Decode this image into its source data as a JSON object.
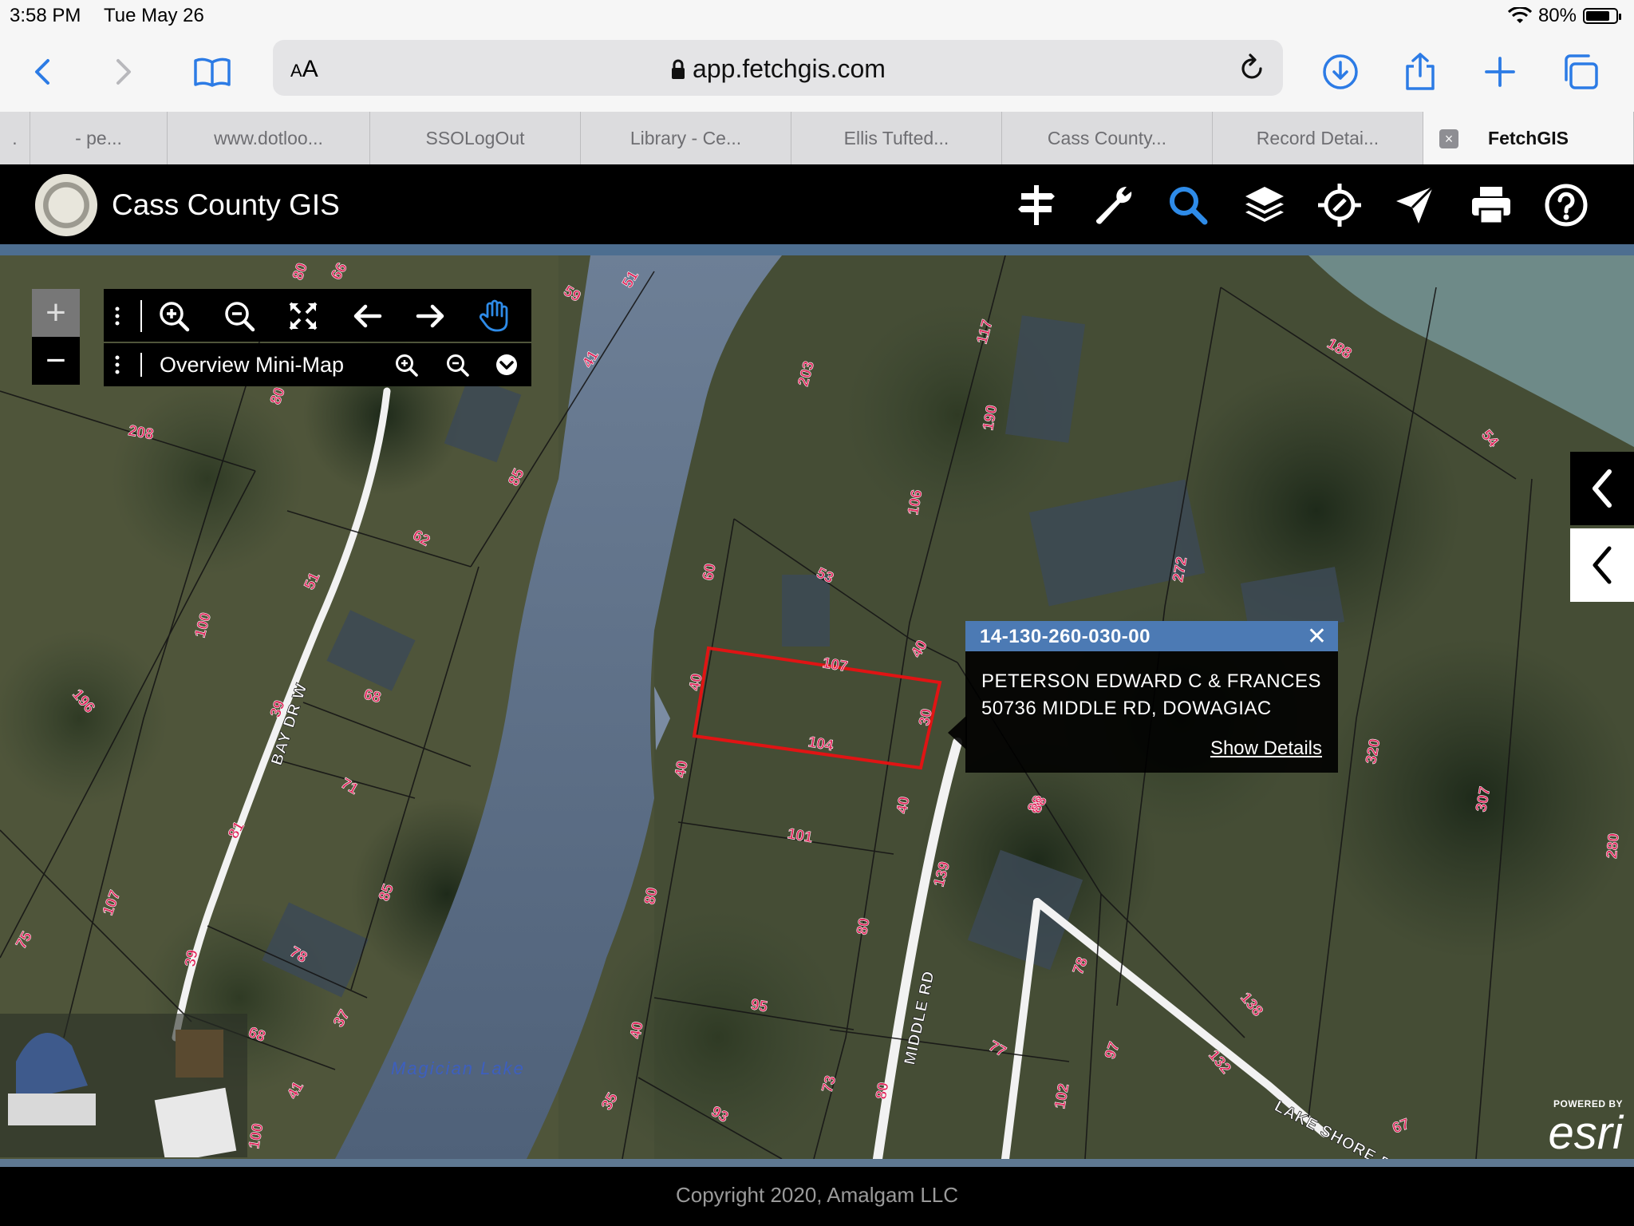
{
  "status_bar": {
    "time": "3:58 PM",
    "date": "Tue May 26",
    "battery_text": "80%",
    "battery_level": 0.8
  },
  "browser": {
    "text_size_label_small": "A",
    "text_size_label_big": "A",
    "url": "app.fetchgis.com",
    "icons": [
      "back-icon",
      "forward-icon",
      "bookmarks-icon",
      "lock-icon",
      "reload-icon",
      "download-icon",
      "share-icon",
      "new-tab-icon",
      "tabs-icon"
    ],
    "tabs": [
      {
        "label": "."
      },
      {
        "label": "- pe..."
      },
      {
        "label": "www.dotloo..."
      },
      {
        "label": "SSOLogOut"
      },
      {
        "label": "Library - Ce..."
      },
      {
        "label": "Ellis Tufted..."
      },
      {
        "label": "Cass County..."
      },
      {
        "label": "Record Detai..."
      },
      {
        "label": "FetchGIS",
        "active": true,
        "close_glyph": "×"
      }
    ]
  },
  "app": {
    "title": "Cass County GIS",
    "header_icons": [
      "directions-icon",
      "wrench-icon",
      "search-icon",
      "layers-icon",
      "locate-icon",
      "navigate-icon",
      "print-icon",
      "help-icon"
    ],
    "active_header_icon": "search-icon",
    "accent_color": "#4c7ab4"
  },
  "map_controls": {
    "zoom_in": "+",
    "zoom_out": "−",
    "tool_icons": [
      "zoom-in-icon",
      "zoom-out-icon",
      "full-extent-icon",
      "previous-extent-icon",
      "next-extent-icon",
      "pan-hand-icon"
    ],
    "active_tool": "pan-hand-icon",
    "minimap_label": "Overview Mini-Map",
    "minimap_icons": [
      "minimap-zoom-in-icon",
      "minimap-zoom-out-icon",
      "minimap-toggle-icon"
    ]
  },
  "popup": {
    "parcel_id": "14-130-260-030-00",
    "close_glyph": "✕",
    "owner": "PETERSON EDWARD C & FRANCES",
    "address": "50736 MIDDLE RD, DOWAGIAC",
    "details_link": "Show Details"
  },
  "map_labels": {
    "lake": "Magician Lake",
    "roads": [
      "BAY DR W",
      "MIDDLE RD",
      "LAKE SHORE DR"
    ],
    "parcel_numbers": [
      "208",
      "80",
      "80",
      "66",
      "59",
      "51",
      "41",
      "203",
      "117",
      "190",
      "106",
      "53",
      "60",
      "107",
      "104",
      "40",
      "40",
      "30",
      "40",
      "40",
      "101",
      "139",
      "80",
      "95",
      "77",
      "73",
      "80",
      "102",
      "97",
      "78",
      "132",
      "138",
      "88",
      "320",
      "307",
      "280",
      "54",
      "188",
      "272",
      "62",
      "51",
      "100",
      "196",
      "75",
      "68",
      "39",
      "71",
      "81",
      "107",
      "85",
      "78",
      "37",
      "68",
      "41",
      "39",
      "100",
      "35",
      "93",
      "40",
      "80",
      "88",
      "85",
      "67"
    ]
  },
  "attribution": {
    "powered_by": "POWERED BY",
    "brand": "esri"
  },
  "footer": {
    "copyright": "Copyright 2020, Amalgam LLC"
  },
  "colors": {
    "parcel_line": "#1a1a1a",
    "parcel_label": "#e0245a",
    "selected_parcel": "#e01010",
    "lake": "#5b6f8a",
    "header_bg": "#000000"
  }
}
